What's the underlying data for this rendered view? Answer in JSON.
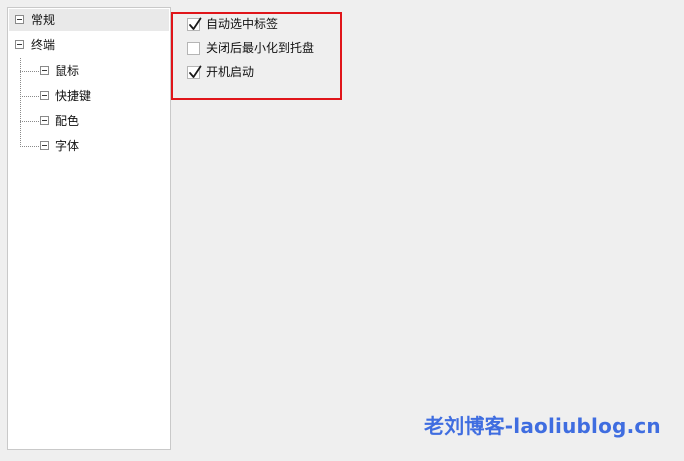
{
  "tree": {
    "items": [
      {
        "label": "常规",
        "level": 0,
        "selected": true,
        "expanded": true
      },
      {
        "label": "终端",
        "level": 0,
        "selected": false,
        "expanded": true
      },
      {
        "label": "鼠标",
        "level": 1,
        "selected": false,
        "expanded": true
      },
      {
        "label": "快捷键",
        "level": 1,
        "selected": false,
        "expanded": true
      },
      {
        "label": "配色",
        "level": 1,
        "selected": false,
        "expanded": true
      },
      {
        "label": "字体",
        "level": 1,
        "selected": false,
        "expanded": true
      }
    ]
  },
  "options": [
    {
      "label": "自动选中标签",
      "checked": true
    },
    {
      "label": "关闭后最小化到托盘",
      "checked": false
    },
    {
      "label": "开机启动",
      "checked": true
    }
  ],
  "watermark": {
    "text": "老刘博客-laoliublog.cn"
  },
  "colors": {
    "highlight_border": "#e0151a",
    "watermark": "#3f6de0",
    "panel_background": "#ffffff",
    "window_background": "#efefef"
  }
}
